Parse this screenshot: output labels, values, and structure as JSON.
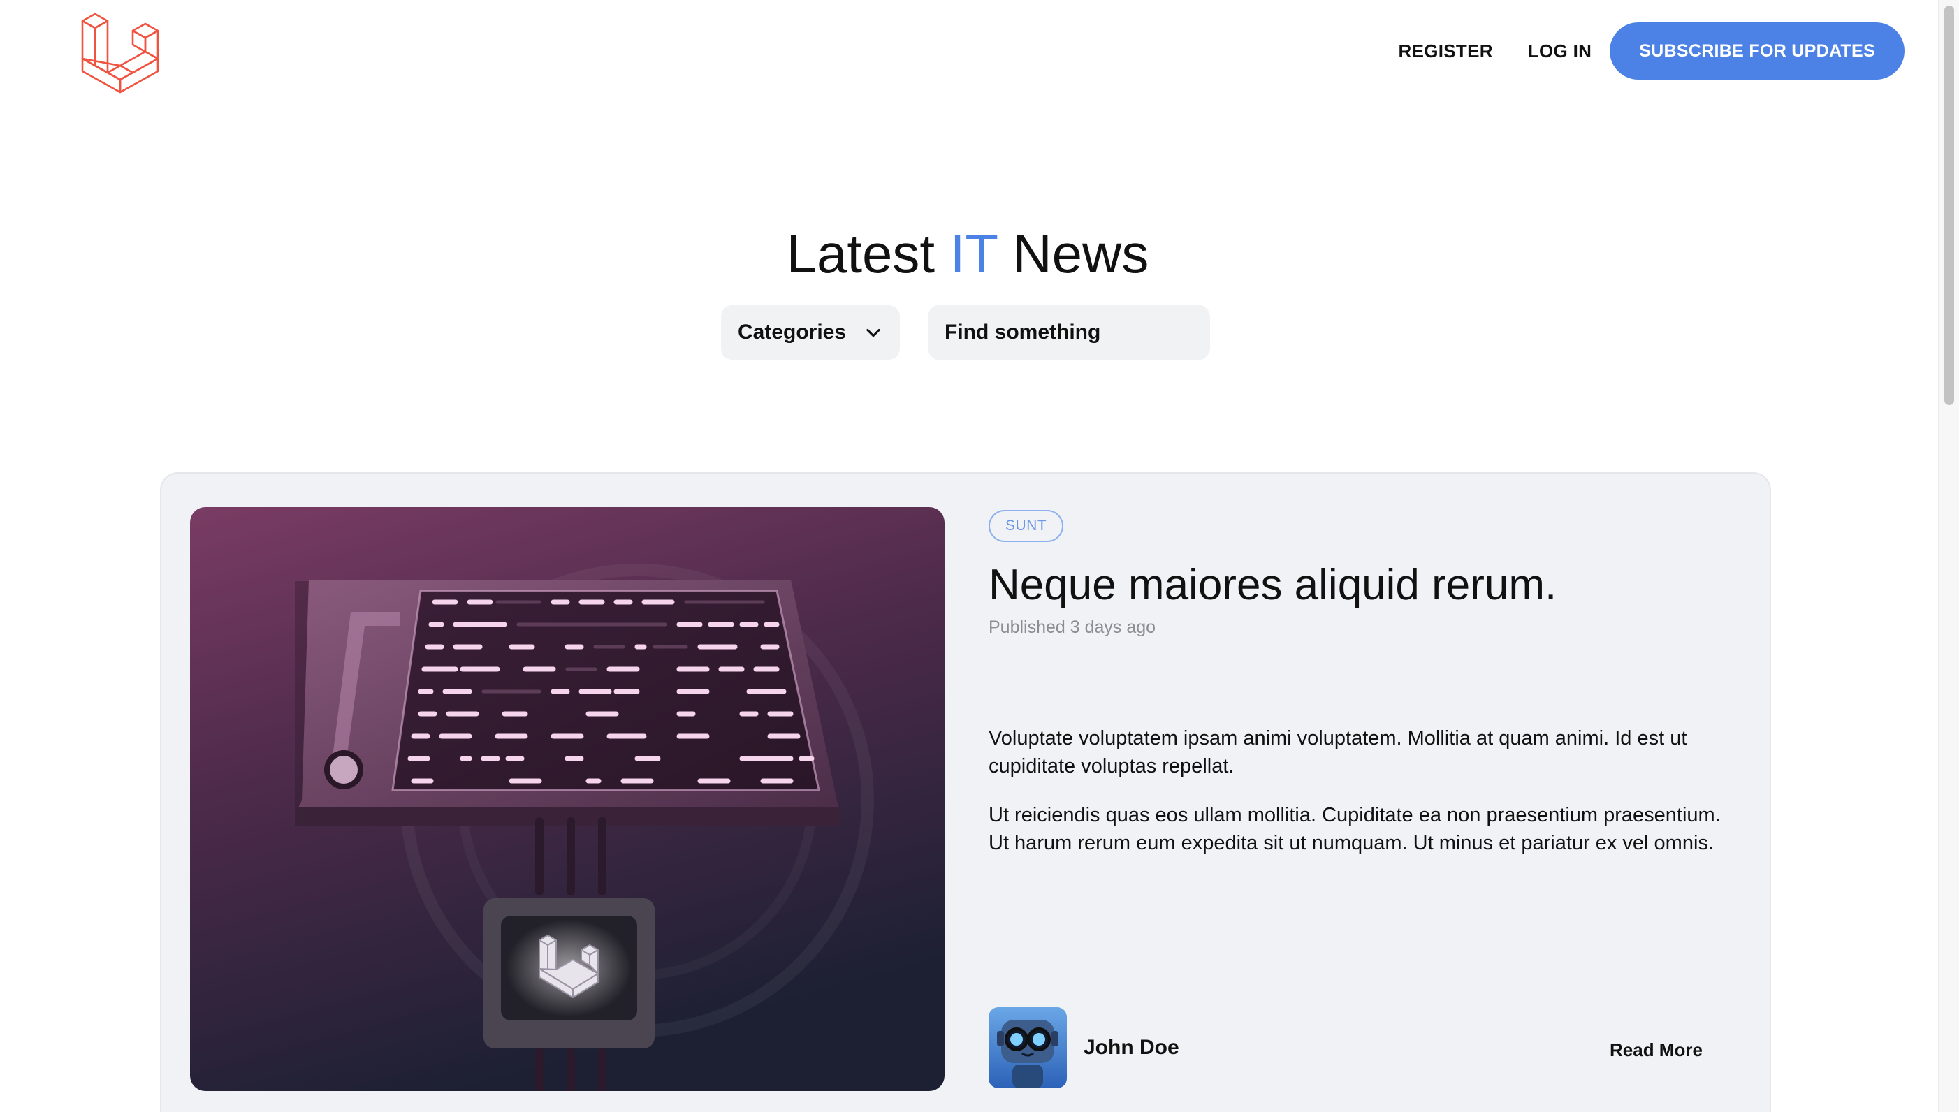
{
  "header": {
    "logo_icon": "laravel-logo-icon",
    "brand_color": "#f05340",
    "nav": {
      "register_label": "REGISTER",
      "login_label": "LOG IN",
      "subscribe_label": "SUBSCRIBE FOR UPDATES"
    },
    "accent_color": "#4c82e6"
  },
  "hero": {
    "title_before": "Latest ",
    "title_accent": "IT",
    "title_after": " News"
  },
  "filters": {
    "category_label": "Categories",
    "category_icon": "chevron-down-icon",
    "search_placeholder": "Find something"
  },
  "featured_post": {
    "image_icon": "laravel-server-illustration",
    "tag": "SUNT",
    "title": "Neque maiores aliquid rerum.",
    "published": "Published 3 days ago",
    "excerpt": [
      "Voluptate voluptatem ipsam animi voluptatem. Mollitia at quam animi. Id est ut cupiditate voluptas repellat.",
      "Ut reiciendis quas eos ullam mollitia. Cupiditate ea non praesentium praesentium. Ut harum rerum eum expedita sit ut numquam. Ut minus et pariatur ex vel omnis."
    ],
    "author": {
      "name": "John Doe",
      "avatar_icon": "robot-avatar"
    },
    "read_more_label": "Read More"
  }
}
